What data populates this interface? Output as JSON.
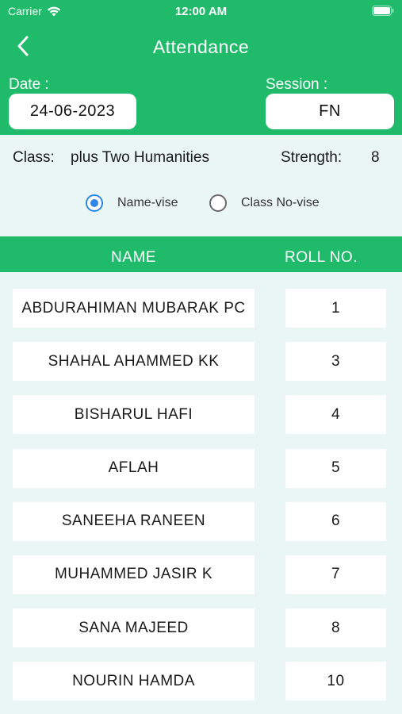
{
  "status_bar": {
    "carrier": "Carrier",
    "time": "12:00 AM"
  },
  "header": {
    "title": "Attendance",
    "date_label": "Date :",
    "date_value": "24-06-2023",
    "session_label": "Session :",
    "session_value": "FN"
  },
  "class_info": {
    "class_label": "Class:",
    "class_value": "plus Two Humanities",
    "strength_label": "Strength:",
    "strength_value": "8"
  },
  "sort_options": [
    {
      "label": "Name-vise",
      "selected": true
    },
    {
      "label": "Class No-vise",
      "selected": false
    }
  ],
  "table": {
    "columns": [
      "NAME",
      "ROLL NO."
    ],
    "rows": [
      {
        "name": "ABDURAHIMAN MUBARAK PC",
        "roll": "1"
      },
      {
        "name": "SHAHAL AHAMMED KK",
        "roll": "3"
      },
      {
        "name": "BISHARUL HAFI",
        "roll": "4"
      },
      {
        "name": "AFLAH",
        "roll": "5"
      },
      {
        "name": "SANEEHA RANEEN",
        "roll": "6"
      },
      {
        "name": "MUHAMMED JASIR K",
        "roll": "7"
      },
      {
        "name": "SANA MAJEED",
        "roll": "8"
      },
      {
        "name": "NOURIN HAMDA",
        "roll": "10"
      }
    ]
  },
  "colors": {
    "primary_green": "#1fba6a",
    "background": "#eaf6f4",
    "radio_selected": "#2f86e6"
  },
  "icons": {
    "back": "chevron-left-icon",
    "wifi": "wifi-icon",
    "battery": "battery-icon"
  }
}
